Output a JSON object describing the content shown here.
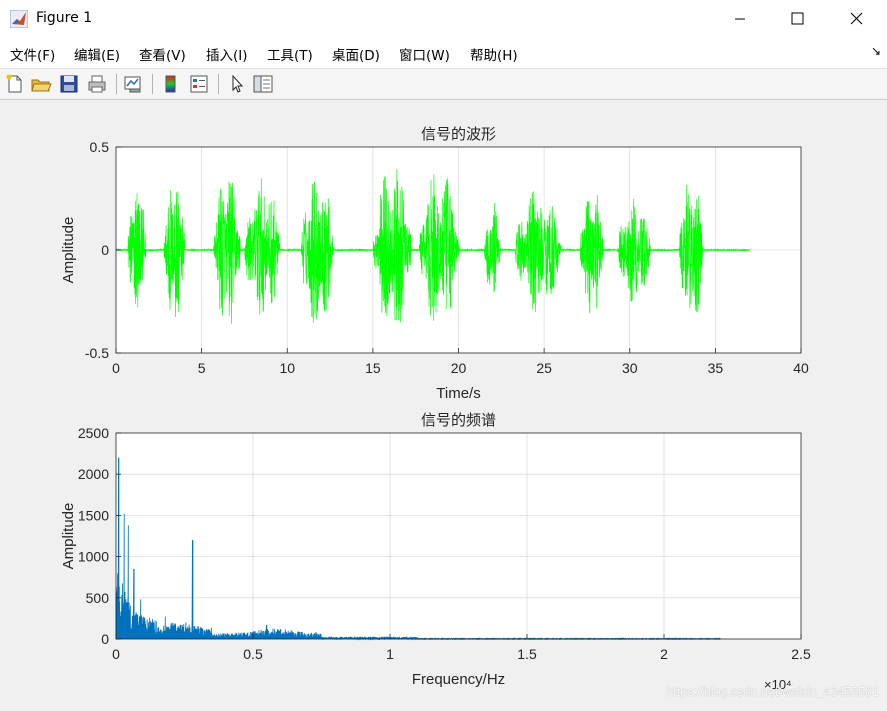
{
  "window": {
    "title": "Figure 1",
    "icon": "matlab-icon",
    "controls": [
      "minimize-icon",
      "maximize-icon",
      "close-icon"
    ]
  },
  "menubar": {
    "items": [
      {
        "label": "文件(F)",
        "name": "file"
      },
      {
        "label": "编辑(E)",
        "name": "edit"
      },
      {
        "label": "查看(V)",
        "name": "view"
      },
      {
        "label": "插入(I)",
        "name": "insert"
      },
      {
        "label": "工具(T)",
        "name": "tools"
      },
      {
        "label": "桌面(D)",
        "name": "desktop"
      },
      {
        "label": "窗口(W)",
        "name": "window"
      },
      {
        "label": "帮助(H)",
        "name": "help"
      }
    ]
  },
  "toolbar": {
    "buttons": [
      "new-figure-icon",
      "open-file-icon",
      "save-icon",
      "print-icon",
      "link-plot-icon",
      "colorbar-icon",
      "legend-icon",
      "pointer-icon",
      "property-editor-icon"
    ]
  },
  "colors": {
    "waveform": "#00ff00",
    "spectrum": "#0072bd",
    "axes_bg": "#ffffff",
    "grid": "#dcdcdc"
  },
  "chart_data": [
    {
      "type": "line",
      "title": "信号的波形",
      "xlabel": "Time/s",
      "ylabel": "Amplitude",
      "xlim": [
        0,
        40
      ],
      "ylim": [
        -0.5,
        0.5
      ],
      "xticks": [
        "0",
        "5",
        "10",
        "15",
        "20",
        "25",
        "30",
        "35",
        "40"
      ],
      "yticks": [
        "-0.5",
        "0",
        "0.5"
      ],
      "grid": true,
      "series": [
        {
          "color": "#00ff00",
          "bursts": [
            {
              "start": 0.7,
              "end": 1.9,
              "amp": 0.36
            },
            {
              "start": 2.8,
              "end": 4.2,
              "amp": 0.41
            },
            {
              "start": 5.7,
              "end": 7.5,
              "amp": 0.4
            },
            {
              "start": 7.5,
              "end": 9.9,
              "amp": 0.36
            },
            {
              "start": 10.8,
              "end": 13.0,
              "amp": 0.4
            },
            {
              "start": 15.0,
              "end": 17.6,
              "amp": 0.43
            },
            {
              "start": 17.7,
              "end": 20.4,
              "amp": 0.4
            },
            {
              "start": 21.5,
              "end": 22.6,
              "amp": 0.26
            },
            {
              "start": 23.3,
              "end": 26.4,
              "amp": 0.32
            },
            {
              "start": 27.1,
              "end": 28.7,
              "amp": 0.34
            },
            {
              "start": 29.3,
              "end": 31.5,
              "amp": 0.27
            },
            {
              "start": 32.9,
              "end": 34.5,
              "amp": 0.43
            }
          ],
          "x_end": 37.0
        }
      ]
    },
    {
      "type": "line",
      "title": "信号的频谱",
      "xlabel": "Frequency/Hz",
      "ylabel": "Amplitude",
      "xlim": [
        0,
        25000
      ],
      "ylim": [
        0,
        2500
      ],
      "xticks": [
        "0",
        "0.5",
        "1",
        "1.5",
        "2",
        "2.5"
      ],
      "yticks": [
        "0",
        "500",
        "1000",
        "1500",
        "2000",
        "2500"
      ],
      "x_multiplier": "×10⁴",
      "grid": true,
      "series": [
        {
          "color": "#0072bd",
          "x_end": 22050,
          "peaks": [
            {
              "x": 100,
              "y": 2200
            },
            {
              "x": 300,
              "y": 1520
            },
            {
              "x": 450,
              "y": 1380
            },
            {
              "x": 650,
              "y": 850
            },
            {
              "x": 900,
              "y": 480
            },
            {
              "x": 1800,
              "y": 270
            },
            {
              "x": 2800,
              "y": 1200
            },
            {
              "x": 5500,
              "y": 170
            },
            {
              "x": 7300,
              "y": 80
            }
          ]
        }
      ]
    }
  ],
  "watermark": "https://blog.csdn.net/weixin_43455581"
}
